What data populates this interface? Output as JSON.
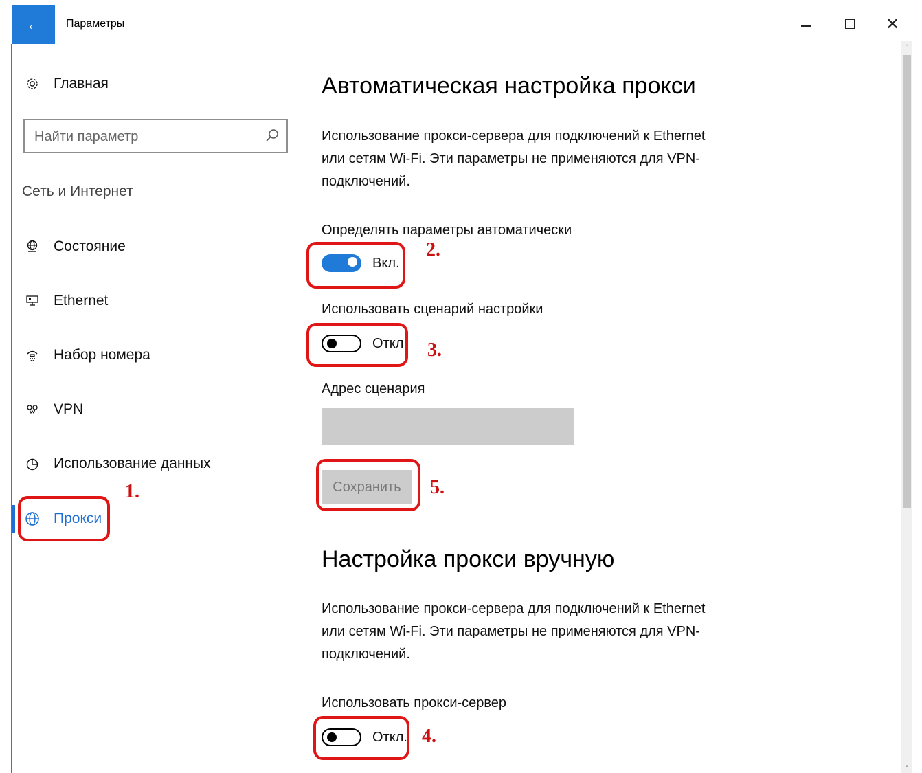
{
  "window": {
    "title": "Параметры"
  },
  "sidebar": {
    "home_label": "Главная",
    "search_placeholder": "Найти параметр",
    "section_label": "Сеть и Интернет",
    "items": [
      {
        "label": "Состояние",
        "icon": "globe-status-icon"
      },
      {
        "label": "Ethernet",
        "icon": "ethernet-icon"
      },
      {
        "label": "Набор номера",
        "icon": "dialup-icon"
      },
      {
        "label": "VPN",
        "icon": "vpn-icon"
      },
      {
        "label": "Использование данных",
        "icon": "data-usage-icon"
      },
      {
        "label": "Прокси",
        "icon": "globe-icon",
        "active": true
      }
    ]
  },
  "auto": {
    "heading": "Автоматическая настройка прокси",
    "description": "Использование прокси-сервера для подключений к Ethernet или сетям Wi-Fi. Эти параметры не применяются для VPN-подключений.",
    "detect_label": "Определять параметры автоматически",
    "detect_state": "Вкл.",
    "script_label": "Использовать сценарий настройки",
    "script_state": "Откл.",
    "address_label": "Адрес сценария",
    "address_value": "",
    "save_label": "Сохранить"
  },
  "manual": {
    "heading": "Настройка прокси вручную",
    "description": "Использование прокси-сервера для подключений к Ethernet или сетям Wi-Fi. Эти параметры не применяются для VPN-подключений.",
    "use_proxy_label": "Использовать прокси-сервер",
    "use_proxy_state": "Откл."
  },
  "annotations": [
    "1.",
    "2.",
    "3.",
    "4.",
    "5."
  ],
  "colors": {
    "accent": "#1f7ad8",
    "annotation": "#e01515"
  }
}
